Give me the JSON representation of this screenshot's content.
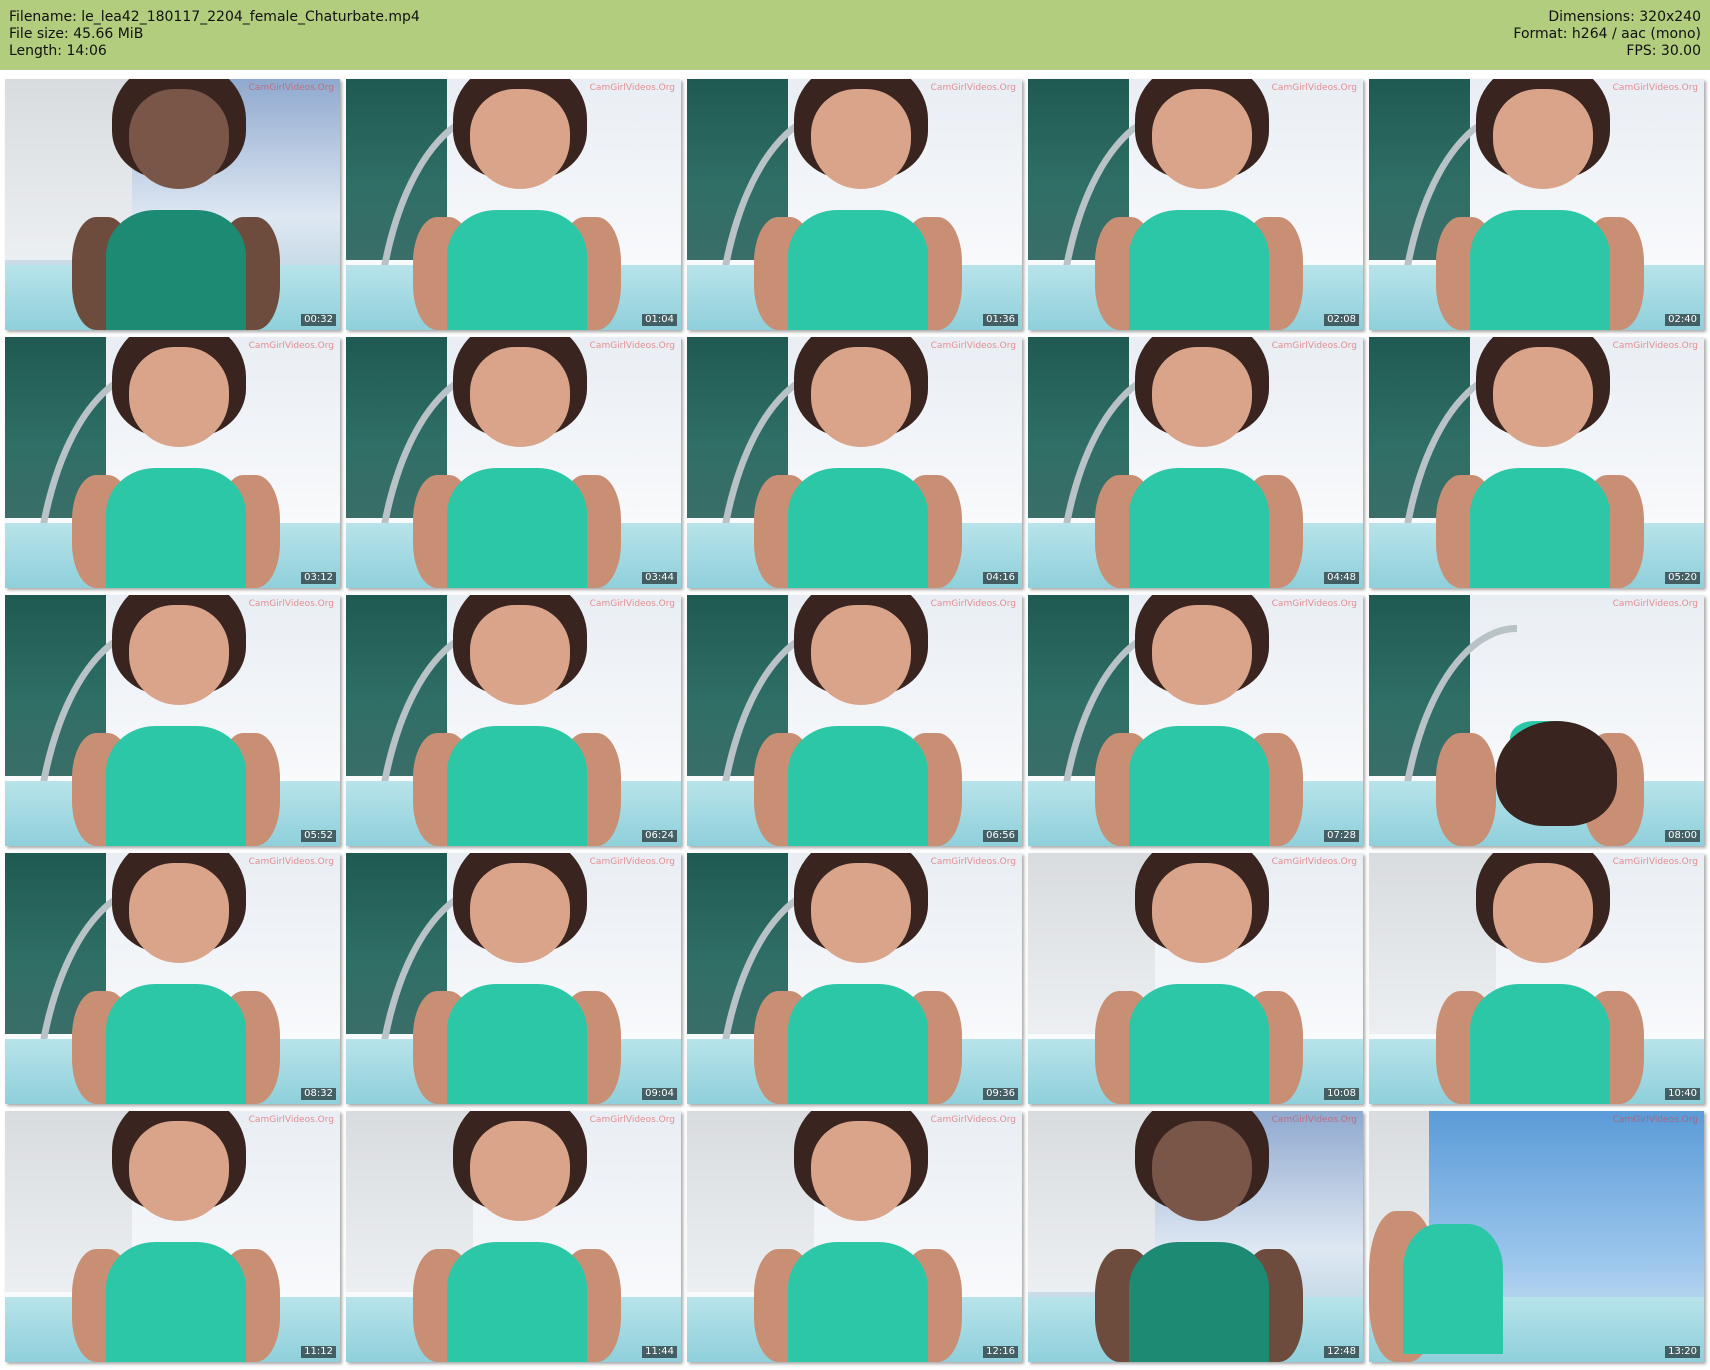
{
  "header": {
    "filename": "Filename: le_lea42_180117_2204_female_Chaturbate.mp4",
    "filesize": "File size: 45.66 MiB",
    "length": "Length: 14:06",
    "dimensions": "Dimensions: 320x240",
    "format": "Format: h264 / aac (mono)",
    "fps": "FPS: 30.00"
  },
  "watermark": "CamGirlVideos.Org",
  "thumbnails": [
    {
      "time": "00:32",
      "watermark": "CamGirlVideos.Org"
    },
    {
      "time": "01:04",
      "watermark": "CamGirlVideos.Org"
    },
    {
      "time": "01:36",
      "watermark": "CamGirlVideos.Org"
    },
    {
      "time": "02:08",
      "watermark": "CamGirlVideos.Org"
    },
    {
      "time": "02:40",
      "watermark": "CamGirlVideos.Org"
    },
    {
      "time": "03:12",
      "watermark": "CamGirlVideos.Org"
    },
    {
      "time": "03:44",
      "watermark": "CamGirlVideos.Org"
    },
    {
      "time": "04:16",
      "watermark": "CamGirlVideos.Org"
    },
    {
      "time": "04:48",
      "watermark": "CamGirlVideos.Org"
    },
    {
      "time": "05:20",
      "watermark": "CamGirlVideos.Org"
    },
    {
      "time": "05:52",
      "watermark": "CamGirlVideos.Org"
    },
    {
      "time": "06:24",
      "watermark": "CamGirlVideos.Org"
    },
    {
      "time": "06:56",
      "watermark": "CamGirlVideos.Org"
    },
    {
      "time": "07:28",
      "watermark": "CamGirlVideos.Org"
    },
    {
      "time": "08:00",
      "watermark": "CamGirlVideos.Org"
    },
    {
      "time": "08:32",
      "watermark": "CamGirlVideos.Org"
    },
    {
      "time": "09:04",
      "watermark": "CamGirlVideos.Org"
    },
    {
      "time": "09:36",
      "watermark": "CamGirlVideos.Org"
    },
    {
      "time": "10:08",
      "watermark": "CamGirlVideos.Org"
    },
    {
      "time": "10:40",
      "watermark": "CamGirlVideos.Org"
    },
    {
      "time": "11:12",
      "watermark": "CamGirlVideos.Org"
    },
    {
      "time": "11:44",
      "watermark": "CamGirlVideos.Org"
    },
    {
      "time": "12:16",
      "watermark": "CamGirlVideos.Org"
    },
    {
      "time": "12:48",
      "watermark": "CamGirlVideos.Org"
    },
    {
      "time": "13:20",
      "watermark": "CamGirlVideos.Org"
    }
  ]
}
